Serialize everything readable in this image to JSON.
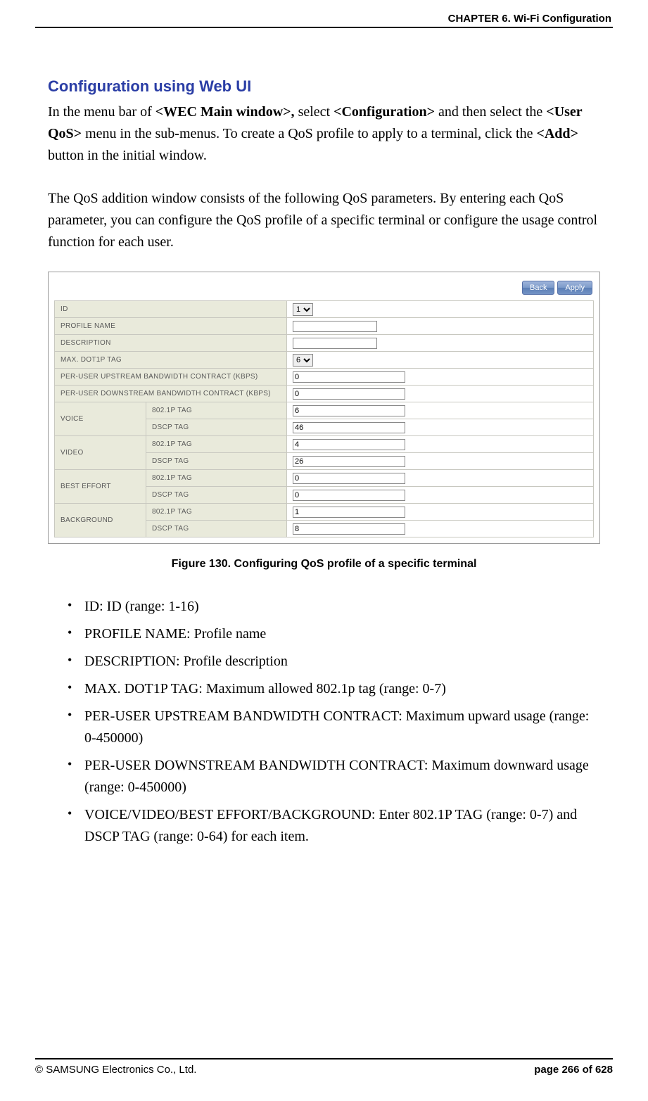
{
  "header": {
    "chapter": "CHAPTER 6. Wi-Fi Configuration"
  },
  "section": {
    "title": "Configuration using Web UI"
  },
  "paragraph1": {
    "t1": "In the menu bar of ",
    "b1": "<WEC Main window>,",
    "t2": " select ",
    "b2": "<Configuration>",
    "t3": " and then select the ",
    "b3": "<User QoS>",
    "t4": " menu in the sub-menus. To create a QoS profile to apply to a terminal, click the ",
    "b4": "<Add>",
    "t5": " button in the initial window."
  },
  "paragraph2": "The QoS addition window consists of the following QoS parameters. By entering each QoS parameter, you can configure the QoS profile of a specific terminal or configure the usage control function for each user.",
  "figure": {
    "buttons": {
      "back": "Back",
      "apply": "Apply"
    },
    "rows": {
      "id_label": "ID",
      "id_value": "1",
      "profile_name_label": "PROFILE NAME",
      "profile_name_value": "",
      "description_label": "DESCRIPTION",
      "description_value": "",
      "max_dot1p_label": "MAX. DOT1P TAG",
      "max_dot1p_value": "6",
      "upstream_label": "PER-USER UPSTREAM BANDWIDTH CONTRACT (KBPS)",
      "upstream_value": "0",
      "downstream_label": "PER-USER DOWNSTREAM BANDWIDTH CONTRACT (KBPS)",
      "downstream_value": "0",
      "voice_label": "VOICE",
      "video_label": "VIDEO",
      "besteffort_label": "BEST EFFORT",
      "background_label": "BACKGROUND",
      "tag_8021p": "802.1P TAG",
      "tag_dscp": "DSCP TAG",
      "voice_8021p": "6",
      "voice_dscp": "46",
      "video_8021p": "4",
      "video_dscp": "26",
      "besteffort_8021p": "0",
      "besteffort_dscp": "0",
      "background_8021p": "1",
      "background_dscp": "8"
    },
    "caption": "Figure 130. Configuring QoS profile of a specific terminal"
  },
  "bullets": {
    "i0": "ID: ID (range: 1-16)",
    "i1": "PROFILE NAME: Profile name",
    "i2": "DESCRIPTION: Profile description",
    "i3": "MAX. DOT1P TAG: Maximum allowed 802.1p tag (range: 0-7)",
    "i4": "PER-USER UPSTREAM BANDWIDTH CONTRACT: Maximum upward usage (range: 0-450000)",
    "i5": "PER-USER DOWNSTREAM BANDWIDTH CONTRACT: Maximum downward usage (range: 0-450000)",
    "i6": "VOICE/VIDEO/BEST EFFORT/BACKGROUND: Enter 802.1P TAG (range: 0-7) and DSCP TAG (range: 0-64) for each item."
  },
  "footer": {
    "copyright": "© SAMSUNG Electronics Co., Ltd.",
    "page": "page 266 of 628"
  }
}
